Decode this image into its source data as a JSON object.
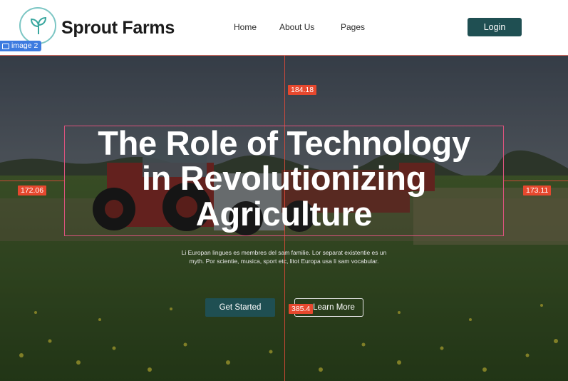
{
  "header": {
    "brand": "Sprout Farms",
    "logo_icon": "sprout-leaf-icon",
    "nav": [
      "Home",
      "About Us",
      "Pages"
    ],
    "login_label": "Login",
    "selection_tag": "image 2"
  },
  "hero": {
    "title_lines": [
      "The Role of Technology",
      "in Revolutionizing",
      "Agriculture"
    ],
    "subtitle_lines": [
      "Li Europan lingues es membres del sam familie. Lor separat existentie es un",
      "myth. Por scientie, musica, sport etc, litot Europa usa li sam vocabular."
    ],
    "primary_button": "Get Started",
    "secondary_button": "Learn More"
  },
  "measurements": {
    "top": "184.18",
    "left": "172.06",
    "right": "173.11",
    "bottom": "385.4"
  },
  "colors": {
    "accent": "#1f4f52",
    "guide": "#e04a3a",
    "measure_badge": "#e6482e",
    "selection_tag": "#3d7be0"
  }
}
